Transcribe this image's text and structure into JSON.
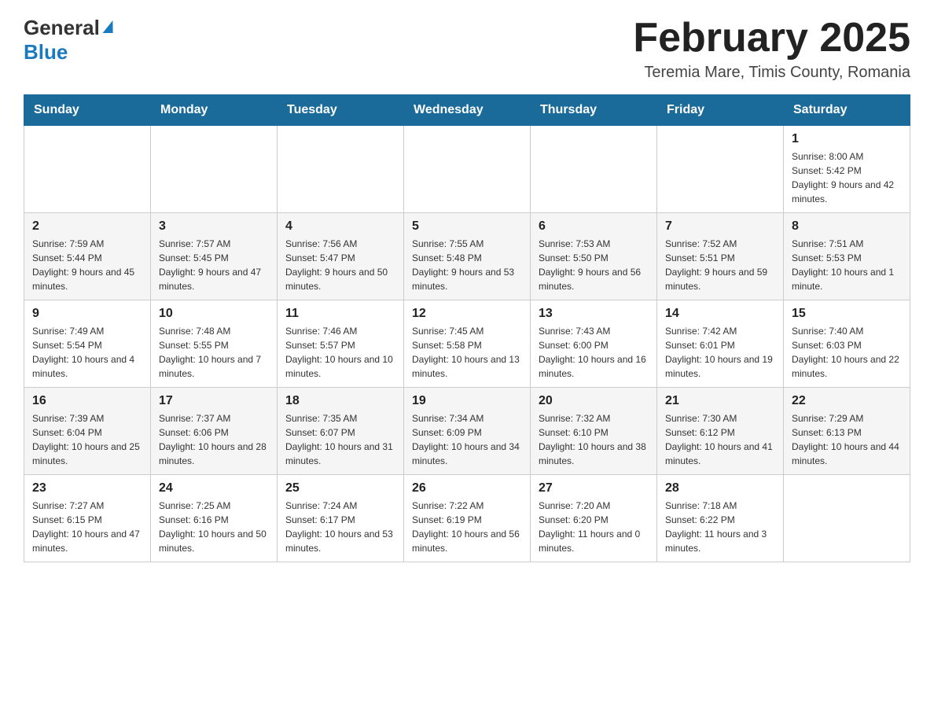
{
  "header": {
    "logo_text_general": "General",
    "logo_text_blue": "Blue",
    "main_title": "February 2025",
    "subtitle": "Teremia Mare, Timis County, Romania"
  },
  "calendar": {
    "days_of_week": [
      "Sunday",
      "Monday",
      "Tuesday",
      "Wednesday",
      "Thursday",
      "Friday",
      "Saturday"
    ],
    "weeks": [
      [
        {
          "day": "",
          "info": ""
        },
        {
          "day": "",
          "info": ""
        },
        {
          "day": "",
          "info": ""
        },
        {
          "day": "",
          "info": ""
        },
        {
          "day": "",
          "info": ""
        },
        {
          "day": "",
          "info": ""
        },
        {
          "day": "1",
          "info": "Sunrise: 8:00 AM\nSunset: 5:42 PM\nDaylight: 9 hours and 42 minutes."
        }
      ],
      [
        {
          "day": "2",
          "info": "Sunrise: 7:59 AM\nSunset: 5:44 PM\nDaylight: 9 hours and 45 minutes."
        },
        {
          "day": "3",
          "info": "Sunrise: 7:57 AM\nSunset: 5:45 PM\nDaylight: 9 hours and 47 minutes."
        },
        {
          "day": "4",
          "info": "Sunrise: 7:56 AM\nSunset: 5:47 PM\nDaylight: 9 hours and 50 minutes."
        },
        {
          "day": "5",
          "info": "Sunrise: 7:55 AM\nSunset: 5:48 PM\nDaylight: 9 hours and 53 minutes."
        },
        {
          "day": "6",
          "info": "Sunrise: 7:53 AM\nSunset: 5:50 PM\nDaylight: 9 hours and 56 minutes."
        },
        {
          "day": "7",
          "info": "Sunrise: 7:52 AM\nSunset: 5:51 PM\nDaylight: 9 hours and 59 minutes."
        },
        {
          "day": "8",
          "info": "Sunrise: 7:51 AM\nSunset: 5:53 PM\nDaylight: 10 hours and 1 minute."
        }
      ],
      [
        {
          "day": "9",
          "info": "Sunrise: 7:49 AM\nSunset: 5:54 PM\nDaylight: 10 hours and 4 minutes."
        },
        {
          "day": "10",
          "info": "Sunrise: 7:48 AM\nSunset: 5:55 PM\nDaylight: 10 hours and 7 minutes."
        },
        {
          "day": "11",
          "info": "Sunrise: 7:46 AM\nSunset: 5:57 PM\nDaylight: 10 hours and 10 minutes."
        },
        {
          "day": "12",
          "info": "Sunrise: 7:45 AM\nSunset: 5:58 PM\nDaylight: 10 hours and 13 minutes."
        },
        {
          "day": "13",
          "info": "Sunrise: 7:43 AM\nSunset: 6:00 PM\nDaylight: 10 hours and 16 minutes."
        },
        {
          "day": "14",
          "info": "Sunrise: 7:42 AM\nSunset: 6:01 PM\nDaylight: 10 hours and 19 minutes."
        },
        {
          "day": "15",
          "info": "Sunrise: 7:40 AM\nSunset: 6:03 PM\nDaylight: 10 hours and 22 minutes."
        }
      ],
      [
        {
          "day": "16",
          "info": "Sunrise: 7:39 AM\nSunset: 6:04 PM\nDaylight: 10 hours and 25 minutes."
        },
        {
          "day": "17",
          "info": "Sunrise: 7:37 AM\nSunset: 6:06 PM\nDaylight: 10 hours and 28 minutes."
        },
        {
          "day": "18",
          "info": "Sunrise: 7:35 AM\nSunset: 6:07 PM\nDaylight: 10 hours and 31 minutes."
        },
        {
          "day": "19",
          "info": "Sunrise: 7:34 AM\nSunset: 6:09 PM\nDaylight: 10 hours and 34 minutes."
        },
        {
          "day": "20",
          "info": "Sunrise: 7:32 AM\nSunset: 6:10 PM\nDaylight: 10 hours and 38 minutes."
        },
        {
          "day": "21",
          "info": "Sunrise: 7:30 AM\nSunset: 6:12 PM\nDaylight: 10 hours and 41 minutes."
        },
        {
          "day": "22",
          "info": "Sunrise: 7:29 AM\nSunset: 6:13 PM\nDaylight: 10 hours and 44 minutes."
        }
      ],
      [
        {
          "day": "23",
          "info": "Sunrise: 7:27 AM\nSunset: 6:15 PM\nDaylight: 10 hours and 47 minutes."
        },
        {
          "day": "24",
          "info": "Sunrise: 7:25 AM\nSunset: 6:16 PM\nDaylight: 10 hours and 50 minutes."
        },
        {
          "day": "25",
          "info": "Sunrise: 7:24 AM\nSunset: 6:17 PM\nDaylight: 10 hours and 53 minutes."
        },
        {
          "day": "26",
          "info": "Sunrise: 7:22 AM\nSunset: 6:19 PM\nDaylight: 10 hours and 56 minutes."
        },
        {
          "day": "27",
          "info": "Sunrise: 7:20 AM\nSunset: 6:20 PM\nDaylight: 11 hours and 0 minutes."
        },
        {
          "day": "28",
          "info": "Sunrise: 7:18 AM\nSunset: 6:22 PM\nDaylight: 11 hours and 3 minutes."
        },
        {
          "day": "",
          "info": ""
        }
      ]
    ]
  }
}
